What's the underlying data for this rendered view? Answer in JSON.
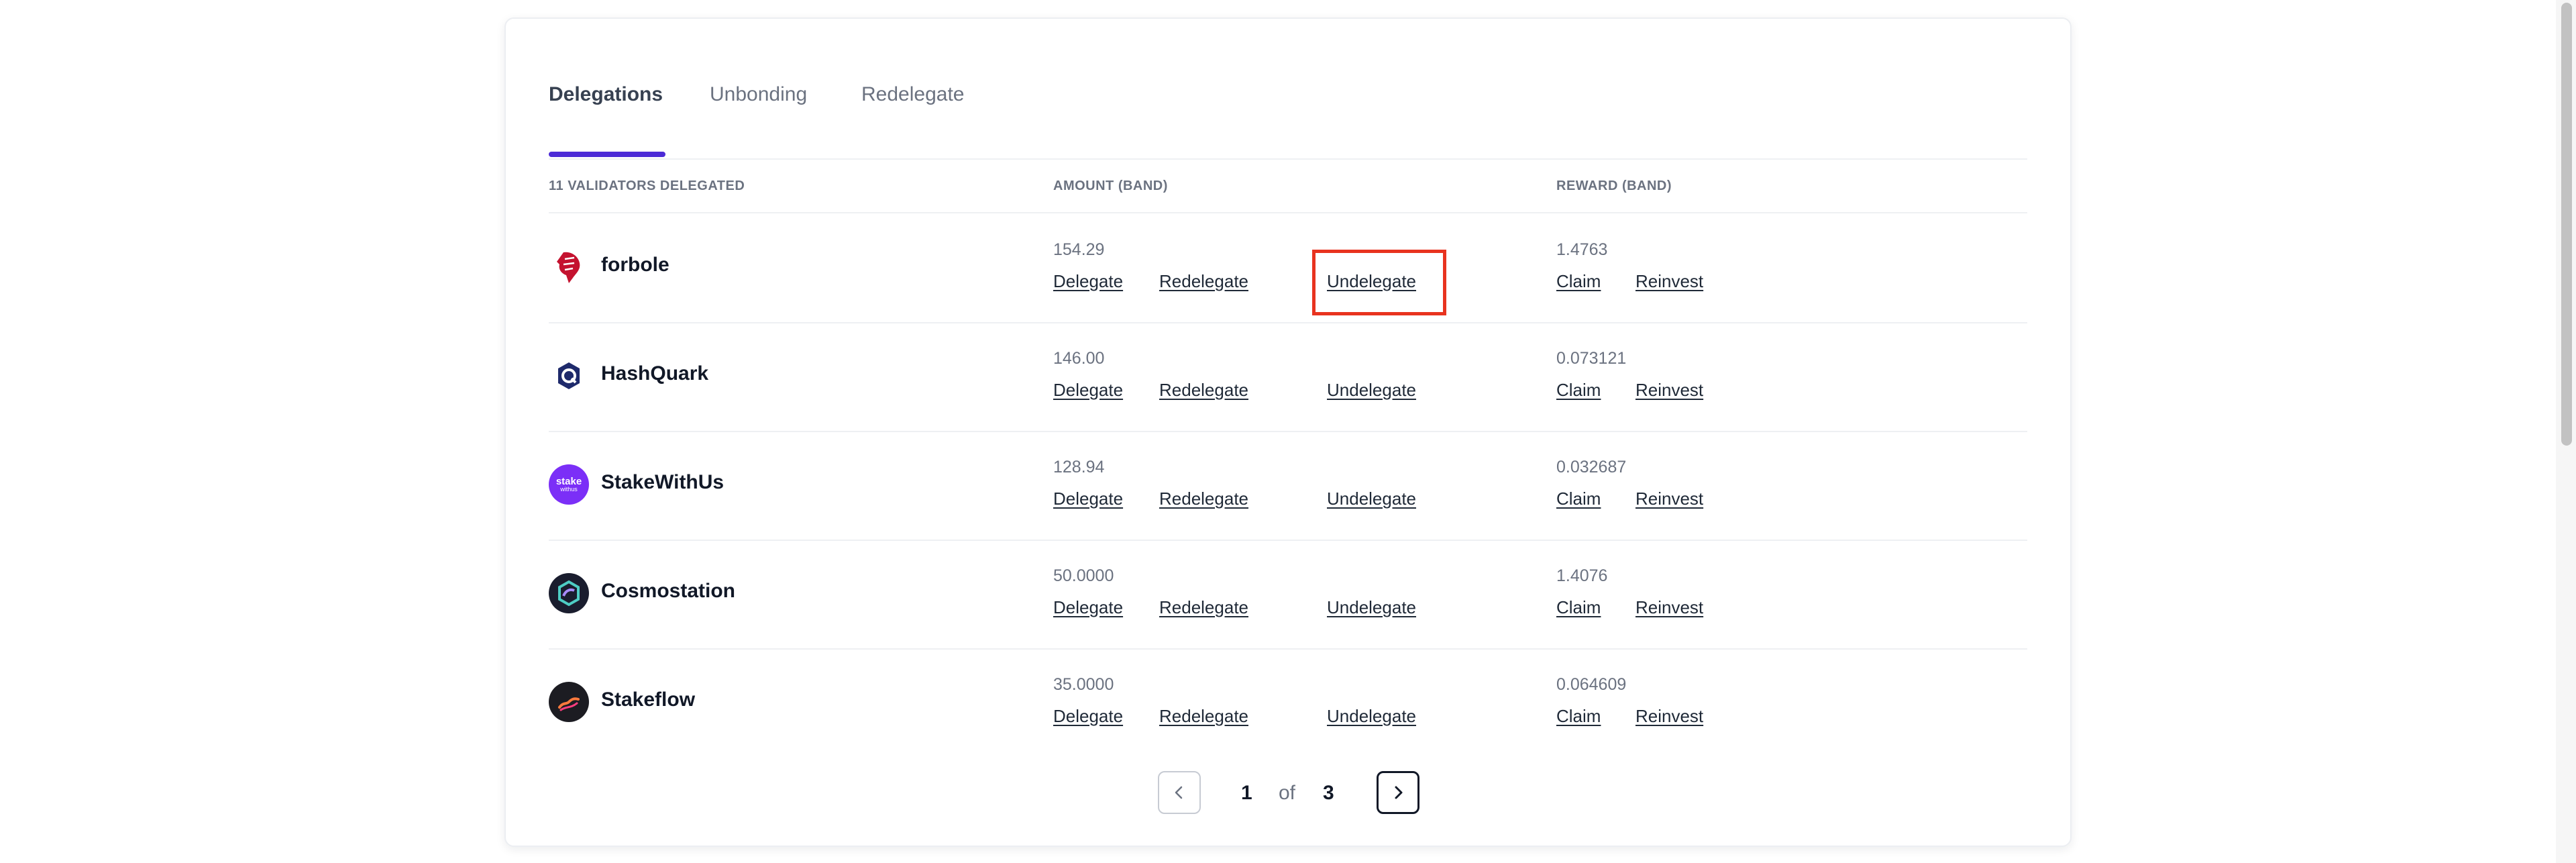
{
  "tabs": [
    {
      "label": "Delegations",
      "active": true
    },
    {
      "label": "Unbonding",
      "active": false
    },
    {
      "label": "Redelegate",
      "active": false
    }
  ],
  "table": {
    "header_validators": "11 VALIDATORS DELEGATED",
    "header_amount": "AMOUNT (BAND)",
    "header_reward": "REWARD (BAND)",
    "action_labels": {
      "delegate": "Delegate",
      "redelegate": "Redelegate",
      "undelegate": "Undelegate",
      "claim": "Claim",
      "reinvest": "Reinvest"
    },
    "rows": [
      {
        "name": "forbole",
        "amount": "154.29",
        "reward": "1.4763",
        "logo_icon": "forbole-logo-icon"
      },
      {
        "name": "HashQuark",
        "amount": "146.00",
        "reward": "0.073121",
        "logo_icon": "hashquark-logo-icon"
      },
      {
        "name": "StakeWithUs",
        "amount": "128.94",
        "reward": "0.032687",
        "logo_icon": "stakewithus-logo-icon",
        "logo_text_top": "stake",
        "logo_text_bottom": "withus"
      },
      {
        "name": "Cosmostation",
        "amount": "50.0000",
        "reward": "1.4076",
        "logo_icon": "cosmostation-logo-icon"
      },
      {
        "name": "Stakeflow",
        "amount": "35.0000",
        "reward": "0.064609",
        "logo_icon": "stakeflow-logo-icon"
      }
    ]
  },
  "pagination": {
    "current": "1",
    "of_label": "of",
    "total": "3",
    "prev_icon": "chevron-left-icon",
    "next_icon": "chevron-right-icon"
  },
  "colors": {
    "accent": "#4b2ad6",
    "highlight": "#e8331f",
    "forbole": "#c4122f",
    "hashquark": "#1e2a6b",
    "stakewithus": "#7b2ff7",
    "cosmostation": "#1a1d2e",
    "stakeflow": "#1c1c22"
  }
}
